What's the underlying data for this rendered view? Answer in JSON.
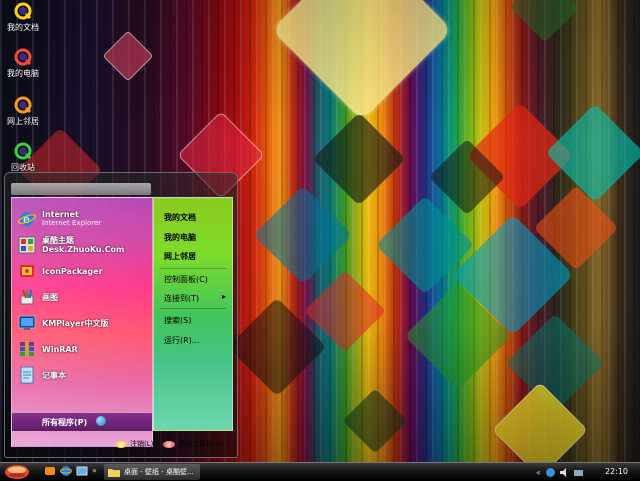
{
  "desktop": {
    "icons": [
      {
        "label": "我的文档",
        "icon": "quicktime-icon"
      },
      {
        "label": "我的电脑",
        "icon": "quicktime-icon"
      },
      {
        "label": "网上邻居",
        "icon": "quicktime-icon"
      },
      {
        "label": "回收站",
        "icon": "quicktime-icon"
      }
    ]
  },
  "start_menu": {
    "programs": [
      {
        "name": "Internet",
        "sub": "Internet Explorer",
        "icon": "internet-explorer-icon"
      },
      {
        "name": "桌酷主题Desk.ZhuoKu.Com",
        "sub": "",
        "icon": "zhuoku-icon"
      },
      {
        "name": "IconPackager",
        "sub": "",
        "icon": "iconpackager-icon"
      },
      {
        "name": "画图",
        "sub": "",
        "icon": "paint-icon"
      },
      {
        "name": "KMPlayer中文版",
        "sub": "",
        "icon": "kmplayer-icon"
      },
      {
        "name": "WinRAR",
        "sub": "",
        "icon": "winrar-icon"
      },
      {
        "name": "记事本",
        "sub": "",
        "icon": "notepad-icon"
      }
    ],
    "all_programs": "所有程序(P)",
    "places": [
      {
        "label": "我的文档"
      },
      {
        "label": "我的电脑"
      },
      {
        "label": "网上邻居"
      },
      {
        "label": "控制面板(C)"
      },
      {
        "label": "连接到(T)"
      },
      {
        "label": "搜索(S)"
      },
      {
        "label": "运行(R)..."
      }
    ],
    "submenu_arrow": "▸",
    "logoff": "注销(L)",
    "shutdown": "关闭计算机(U)"
  },
  "taskbar": {
    "task_label": "桌面 - 壁纸 - 桌酷壁...",
    "clock": "22:10"
  },
  "colors": {
    "start_left_panel": "#ff3b8c",
    "start_right_panel": "#7bdc2b",
    "taskbar": "#161616"
  }
}
